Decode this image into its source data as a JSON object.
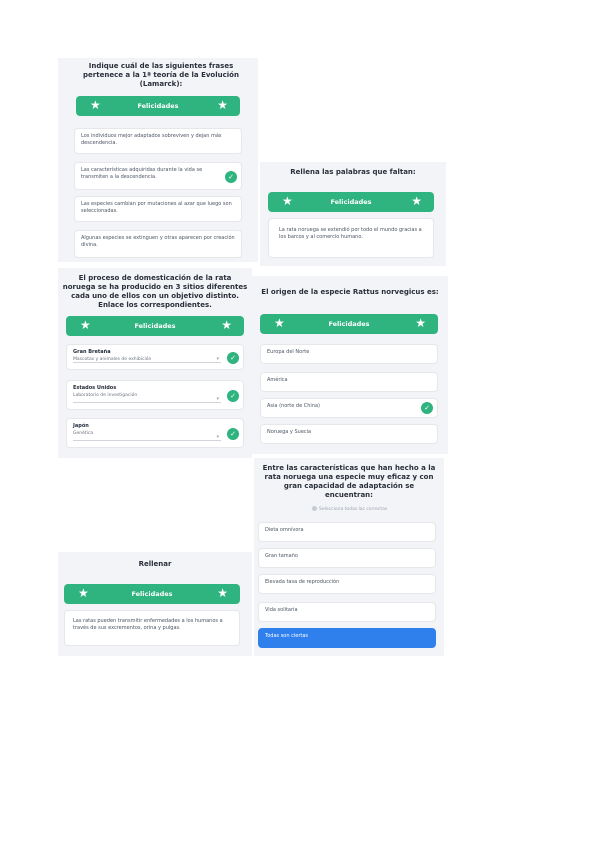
{
  "banner_label": "Felicidades",
  "star": "★",
  "check": "✓",
  "p1": {
    "question": "Indique cuál de las siguientes frases pertenece a la 1ª teoría de la Evolución (Lamarck):",
    "options": [
      "Los individuos mejor adaptados sobreviven y dejan más descendencia.",
      "Las características adquiridas durante la vida se transmiten a la descendencia.",
      "Las especies cambian por mutaciones al azar que luego son seleccionadas.",
      "Algunas especies se extinguen y otras aparecen por creación divina."
    ]
  },
  "p2": {
    "question": "Rellena las palabras que faltan:",
    "text": "La rata noruega se extendió por todo el mundo gracias a los barcos y al comercio humano."
  },
  "p3": {
    "question": "El proceso de domesticación de la rata noruega se ha producido en 3 sitios diferentes cada uno de ellos con un objetivo distinto. Enlace los correspondientes.",
    "items": [
      {
        "label": "Gran Bretaña",
        "value": "Mascotas y animales de exhibición"
      },
      {
        "label": "Estados Unidos",
        "value": "Laboratorio de investigación"
      },
      {
        "label": "Japón",
        "value": "Genética"
      }
    ]
  },
  "p4": {
    "question": "El origen de la especie Rattus norvegicus es:",
    "options": [
      "Europa del Norte",
      "América",
      "Asia (norte de China)",
      "Noruega y Suecia"
    ]
  },
  "p5": {
    "question": "Entre las características que han hecho a la rata noruega una especie muy eficaz y con gran capacidad de adaptación se encuentran:",
    "hint": "Selecciona todas las correctas",
    "options": [
      "Dieta omnívora",
      "Gran tamaño",
      "Elevada tasa de reproducción",
      "Vida solitaria",
      "Todas son ciertas"
    ]
  },
  "p6": {
    "question": "Rellenar",
    "text": "Las ratas pueden transmitir enfermedades a los humanos a través de sus excrementos, orina y pulgas."
  },
  "colors": {
    "accent": "#2fb37f",
    "selected": "#2f80ed",
    "panel": "#f3f4f8"
  }
}
